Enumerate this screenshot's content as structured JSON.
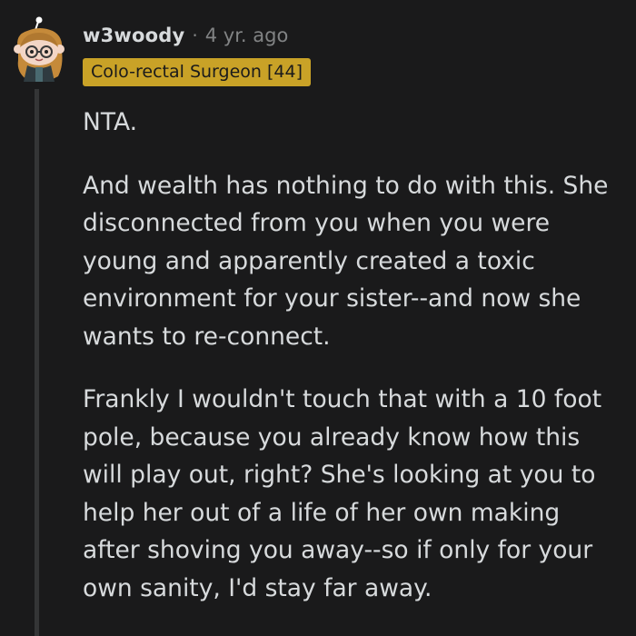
{
  "comment": {
    "username": "w3woody",
    "separator": "·",
    "timestamp": "4 yr. ago",
    "flair": "Colo-rectal Surgeon [44]",
    "avatar_icon": "snoo-avatar-icon",
    "paragraphs": [
      "NTA.",
      "And wealth has nothing to do with this. She disconnected from you when you were young and apparently created a toxic environment for your sister--and now she wants to re-connect.",
      "Frankly I wouldn't touch that with a 10 foot pole, because you already know how this will play out, right? She's looking at you to help her out of a life of her own making after shoving you away--so if only for your own sanity, I'd stay far away."
    ]
  },
  "colors": {
    "background": "#1a1a1b",
    "text": "#d7dadc",
    "meta": "#818384",
    "flair_bg": "#c9a227",
    "thread_line": "#343536"
  }
}
